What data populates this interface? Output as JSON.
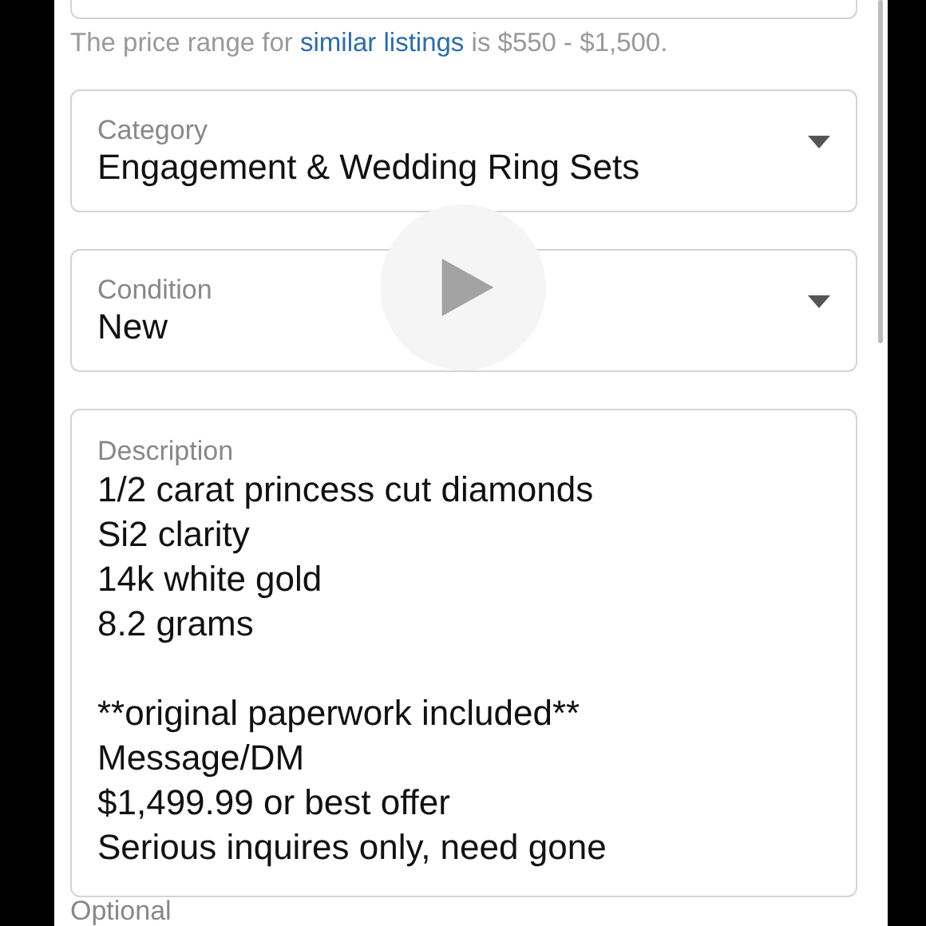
{
  "price_hint": {
    "text": "The price range for ",
    "link": "similar listings",
    "suffix": " is $550 - $1,500."
  },
  "selects": [
    {
      "label": "Category",
      "value": "Engagement & Wedding Ring Sets"
    },
    {
      "label": "Condition",
      "value": "New"
    }
  ],
  "description": {
    "label": "Description",
    "paragraphs": [
      "1/2 carat princess cut diamonds\nSi2 clarity\n14k white gold\n8.2 grams",
      "**original paperwork included**\nMessage/DM\n$1,499.99 or best offer\nSerious inquires only, need gone"
    ]
  },
  "next_label": "Optional"
}
